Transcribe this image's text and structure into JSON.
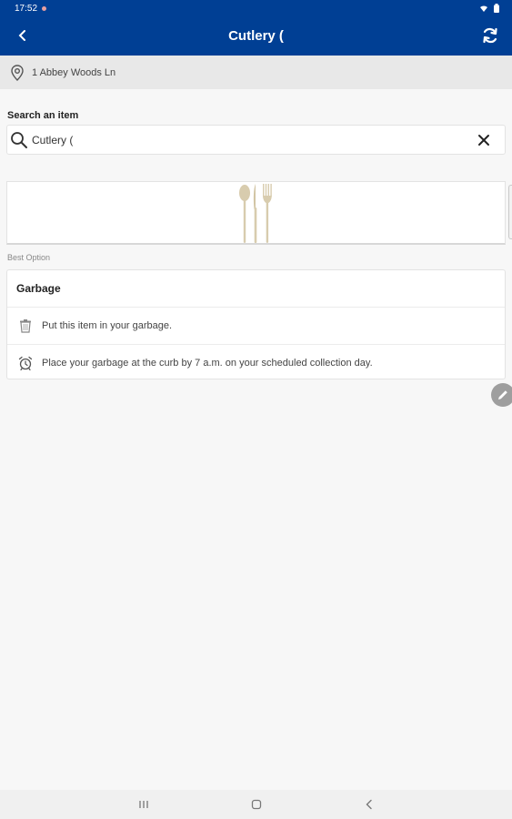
{
  "status_bar": {
    "time": "17:52"
  },
  "app_bar": {
    "title": "Cutlery ("
  },
  "address": {
    "text": "1 Abbey Woods Ln"
  },
  "search": {
    "label": "Search an item",
    "value": "Cutlery ("
  },
  "section": {
    "best_option_label": "Best Option"
  },
  "result": {
    "title": "Garbage",
    "instructions": [
      {
        "icon": "garbage-bin-icon",
        "text": "Put this item in your garbage."
      },
      {
        "icon": "alarm-clock-icon",
        "text": "Place your garbage at the curb by 7 a.m. on your scheduled collection day."
      }
    ]
  },
  "colors": {
    "app_bar": "#003f94",
    "background": "#f7f7f7",
    "cutlery": "#d8ccae"
  }
}
